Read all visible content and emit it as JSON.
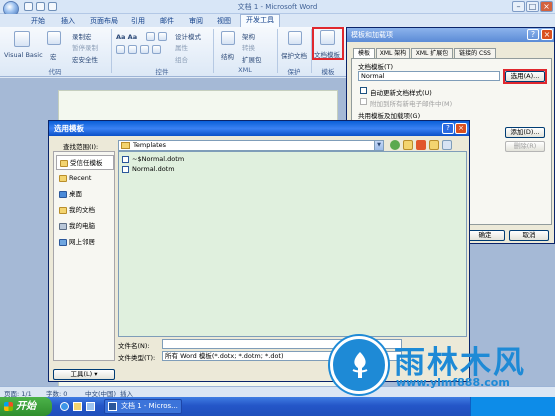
{
  "window": {
    "title": "文档 1 - Microsoft Word",
    "min": "–",
    "max": "□",
    "close": "×"
  },
  "tabs": [
    {
      "label": "开始"
    },
    {
      "label": "插入"
    },
    {
      "label": "页面布局"
    },
    {
      "label": "引用"
    },
    {
      "label": "邮件"
    },
    {
      "label": "审阅"
    },
    {
      "label": "视图"
    },
    {
      "label": "开发工具",
      "active": true
    }
  ],
  "ribbon": {
    "code": {
      "label": "代码",
      "visual_basic": "Visual Basic",
      "macros": "宏",
      "record_macro": "录制宏",
      "pause_recording": "暂停录制",
      "macro_security": "宏安全性"
    },
    "controls": {
      "label": "控件",
      "design_mode": "设计模式",
      "properties": "属性",
      "group": "组合"
    },
    "xml": {
      "label": "XML",
      "structure": "结构",
      "schema": "架构",
      "transform": "转换",
      "expansion_packs": "扩展包"
    },
    "protect": {
      "label": "保护",
      "protect_document": "保护文档"
    },
    "templates": {
      "label": "模板",
      "document_template": "文档模板"
    }
  },
  "addins_dialog": {
    "title": "模板和加载项",
    "help": "?",
    "close": "×",
    "tabs": [
      "模板",
      "XML 架构",
      "XML 扩展包",
      "链接的 CSS"
    ],
    "doc_template_label": "文档模板(T)",
    "doc_template_value": "Normal",
    "attach_button": "选用(A)...",
    "auto_update": "自动更新文档样式(U)",
    "attach_all": "附加到所有新电子邮件中(M)",
    "shared_label": "共用模板及加载项(G)",
    "add_button": "添加(D)...",
    "remove_button": "删除(R)",
    "ok_button": "确定",
    "cancel_button": "取消"
  },
  "select_dialog": {
    "title": "选用模板",
    "help": "?",
    "close": "×",
    "lookin_label": "查找范围(I):",
    "lookin_value": "Templates",
    "places": [
      "受信任模板",
      "Recent",
      "桌面",
      "我的文档",
      "我的电脑",
      "网上邻居"
    ],
    "files": [
      "~$Normal.dotm",
      "Normal.dotm"
    ],
    "filename_label": "文件名(N):",
    "filename_value": "",
    "filetype_label": "文件类型(T):",
    "filetype_value": "所有 Word 模板(*.dotx; *.dotm; *.dot)",
    "tools_button": "工具(L)"
  },
  "statusbar": {
    "page": "页面: 1/1",
    "words": "字数: 0",
    "language": "中文(中国)",
    "mode": "插入"
  },
  "taskbar": {
    "start": "开始",
    "task": "文档 1 - Micros..."
  },
  "watermark": {
    "brand": "雨林木风",
    "url": "www.ylmf888.com"
  },
  "colors": {
    "highlight_red": "#e0282e",
    "xp_title_blue": "#0a5fd8",
    "watermark_blue": "#1e8ad6"
  }
}
